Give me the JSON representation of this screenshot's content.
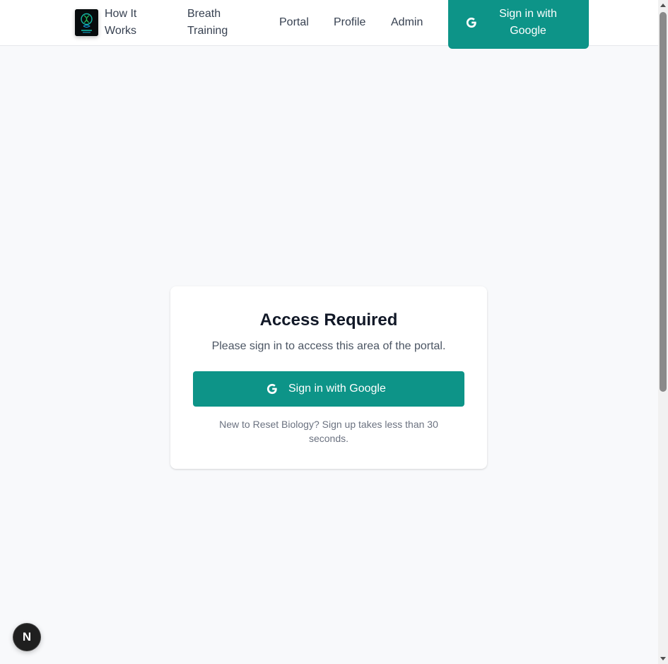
{
  "navbar": {
    "logo_icon": "reset-biology-logo-icon",
    "links": {
      "how_it_works": "How It Works",
      "breath_training": "Breath Training",
      "portal": "Portal",
      "profile": "Profile",
      "admin": "Admin"
    },
    "signin_label": "Sign in with Google",
    "signin_icon": "google-icon"
  },
  "card": {
    "title": "Access Required",
    "subtitle": "Please sign in to access this area of the portal.",
    "button_label": "Sign in with Google",
    "button_icon": "google-icon",
    "note": "New to Reset Biology? Sign up takes less than 30 seconds."
  },
  "devtools": {
    "label": "N",
    "icon": "nextjs-devtools-icon"
  },
  "colors": {
    "accent": "#0d9488",
    "background": "#f8f9fb",
    "card": "#ffffff",
    "title_text": "#111827",
    "muted_text": "#6b7280"
  }
}
